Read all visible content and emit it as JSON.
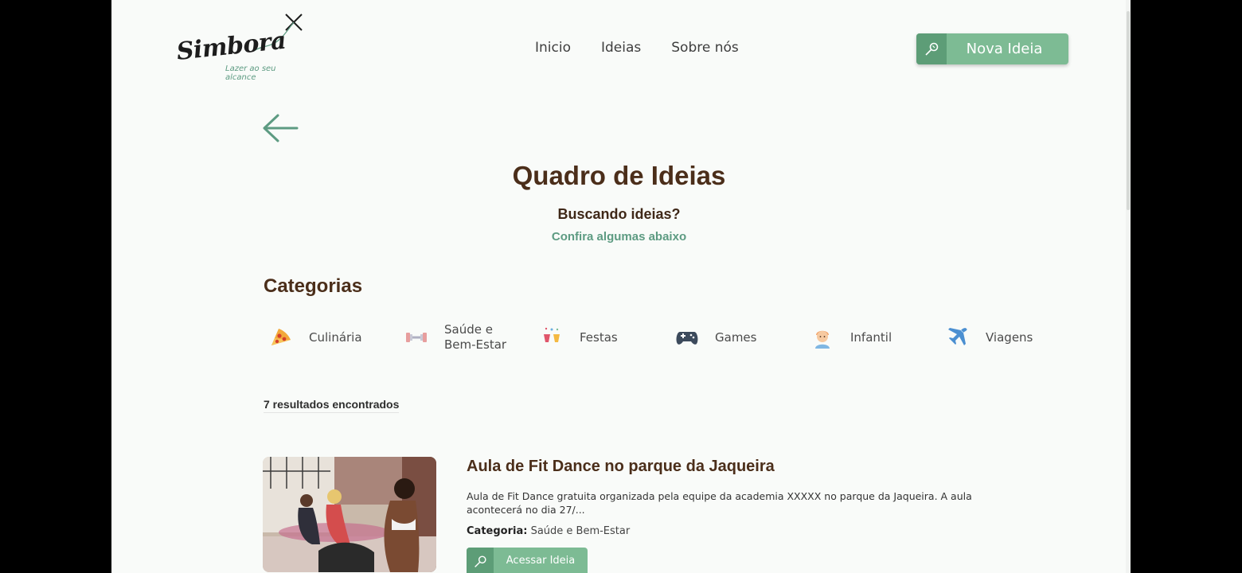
{
  "brand": {
    "name": "Simbora",
    "tagline": "Lazer ao seu alcance",
    "logo_icon": "kite-icon"
  },
  "nav": {
    "items": [
      {
        "label": "Inicio"
      },
      {
        "label": "Ideias"
      },
      {
        "label": "Sobre nós"
      }
    ]
  },
  "header": {
    "new_idea_label": "Nova Ideia",
    "new_idea_icon": "lightbulb-icon"
  },
  "hero": {
    "title": "Quadro de Ideias",
    "subtitle": "Buscando ideias?",
    "subtitle_link": "Confira algumas abaixo"
  },
  "categories": {
    "heading": "Categorias",
    "items": [
      {
        "label": "Culinária",
        "icon": "pizza-icon"
      },
      {
        "label": "Saúde e Bem-Estar",
        "icon": "dumbbell-icon"
      },
      {
        "label": "Festas",
        "icon": "party-icon"
      },
      {
        "label": "Games",
        "icon": "gamepad-icon"
      },
      {
        "label": "Infantil",
        "icon": "baby-icon"
      },
      {
        "label": "Viagens",
        "icon": "airplane-icon"
      }
    ]
  },
  "results": {
    "count_label": "7 resultados encontrados",
    "cards": [
      {
        "title": "Aula de Fit Dance no parque da Jaqueira",
        "description": "Aula de Fit Dance gratuita organizada pela equipe da academia XXXXX no parque da Jaqueira. A aula acontecerá no dia 27/...",
        "category_label": "Categoria:",
        "category_value": "Saúde e Bem-Estar",
        "button_label": "Acessar Ideia"
      }
    ]
  },
  "colors": {
    "accent": "#7dbb94",
    "accent_dark": "#5d9d77",
    "heading": "#4b2e1a",
    "link": "#5d9b82"
  }
}
